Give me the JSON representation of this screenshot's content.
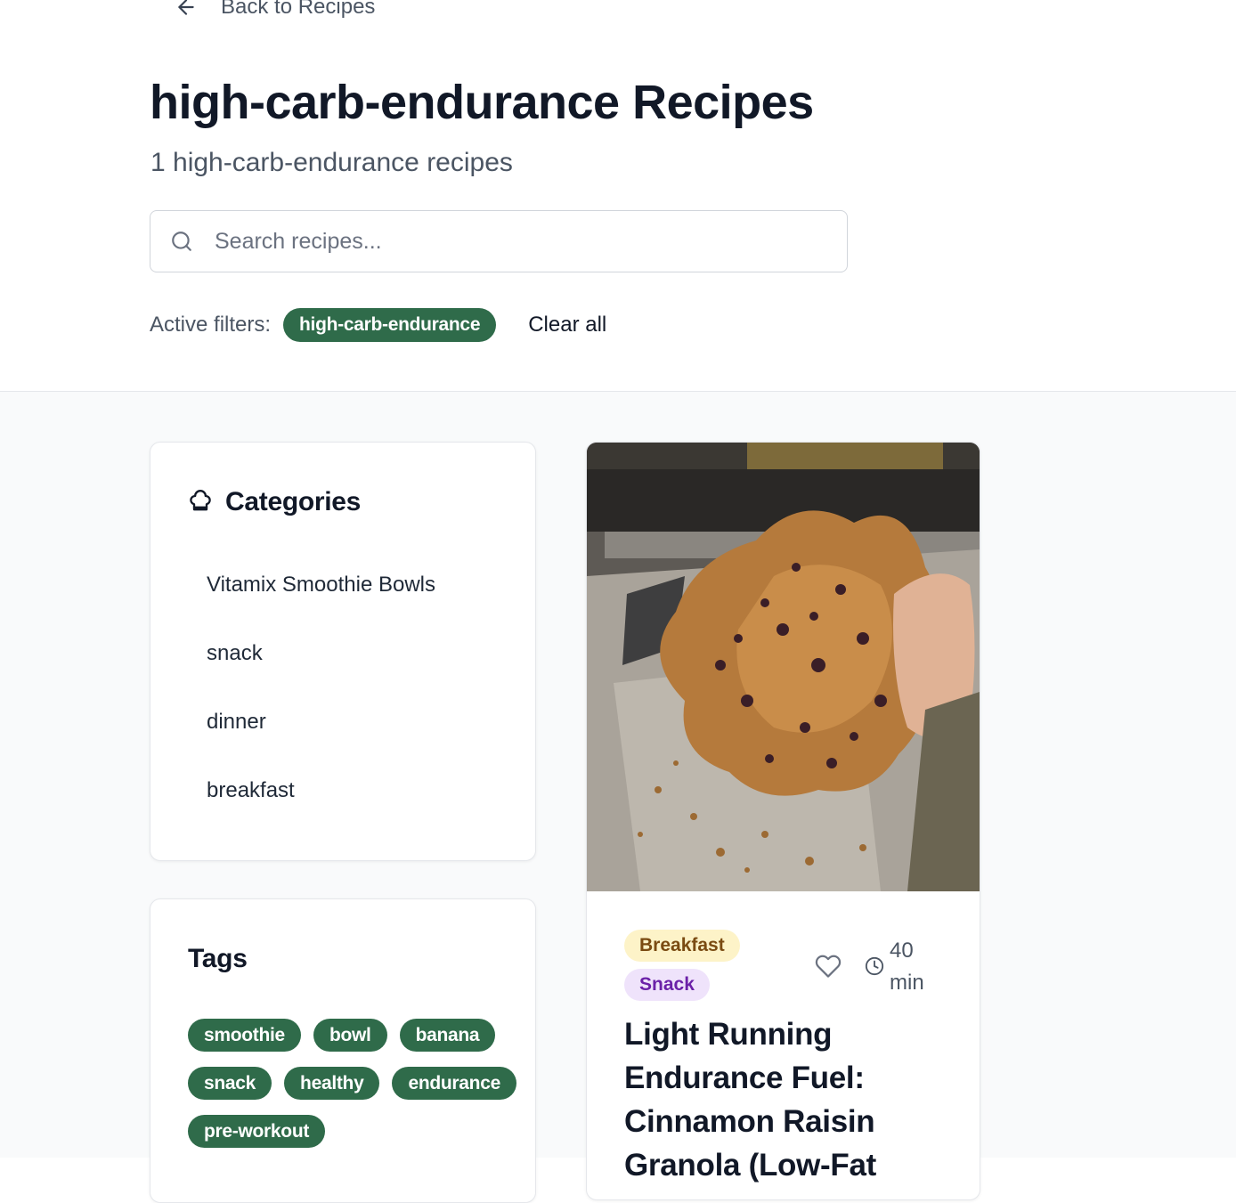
{
  "nav": {
    "back_label": "Back to Recipes"
  },
  "header": {
    "title": "high-carb-endurance Recipes",
    "subtitle": "1 high-carb-endurance recipes"
  },
  "search": {
    "placeholder": "Search recipes...",
    "value": ""
  },
  "filters": {
    "label": "Active filters:",
    "active": "high-carb-endurance",
    "clear_label": "Clear all"
  },
  "categories": {
    "title": "Categories",
    "icon": "chef-hat-icon",
    "items": [
      "Vitamix Smoothie Bowls",
      "snack",
      "dinner",
      "breakfast"
    ]
  },
  "tags": {
    "title": "Tags",
    "items": [
      "smoothie",
      "bowl",
      "banana",
      "snack",
      "healthy",
      "endurance",
      "pre-workout"
    ]
  },
  "recipe": {
    "badges": [
      "Breakfast",
      "Snack"
    ],
    "time": "40 min",
    "title": "Light Running Endurance Fuel: Cinnamon Raisin Granola (Low-Fat",
    "image_alt": "granola-photo"
  },
  "colors": {
    "accent_green": "#2f6b4a",
    "breakfast_badge_bg": "#fdf3c8",
    "breakfast_badge_text": "#7a4b12",
    "snack_badge_bg": "#efe3fb",
    "snack_badge_text": "#6b21a8"
  }
}
